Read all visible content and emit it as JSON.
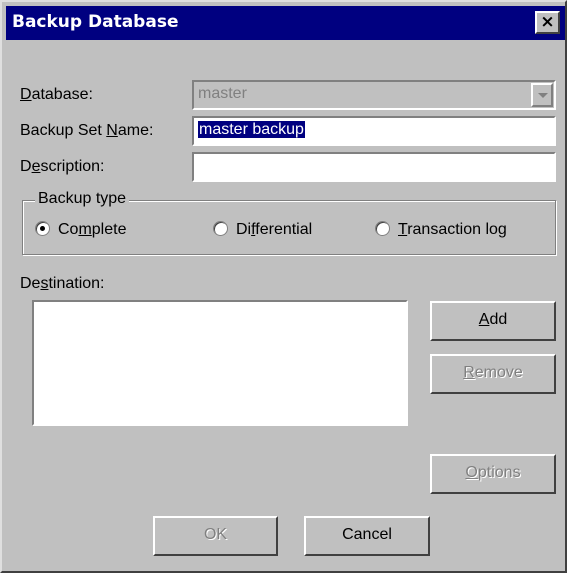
{
  "window": {
    "title": "Backup Database",
    "close_glyph": "×"
  },
  "database": {
    "label_pre": "",
    "label_mnemonic": "D",
    "label_post": "atabase:",
    "value": "master"
  },
  "backup_set_name": {
    "label_pre": "Backup Set ",
    "label_mnemonic": "N",
    "label_post": "ame:",
    "value": "master backup"
  },
  "description": {
    "label_pre": "D",
    "label_mnemonic": "e",
    "label_post": "scription:",
    "value": ""
  },
  "backup_type": {
    "legend": "Backup type",
    "options": [
      {
        "pre": "Co",
        "mnemonic": "m",
        "post": "plete",
        "checked": true
      },
      {
        "pre": "Di",
        "mnemonic": "f",
        "post": "ferential",
        "checked": false
      },
      {
        "pre": "",
        "mnemonic": "T",
        "post": "ransaction log",
        "checked": false
      }
    ]
  },
  "destination": {
    "label_pre": "De",
    "label_mnemonic": "s",
    "label_post": "tination:",
    "items": []
  },
  "buttons": {
    "add": {
      "pre": "",
      "mnemonic": "A",
      "post": "dd"
    },
    "remove": {
      "pre": "",
      "mnemonic": "R",
      "post": "emove"
    },
    "options": {
      "pre": "",
      "mnemonic": "O",
      "post": "ptions"
    },
    "ok": "OK",
    "cancel": "Cancel"
  }
}
